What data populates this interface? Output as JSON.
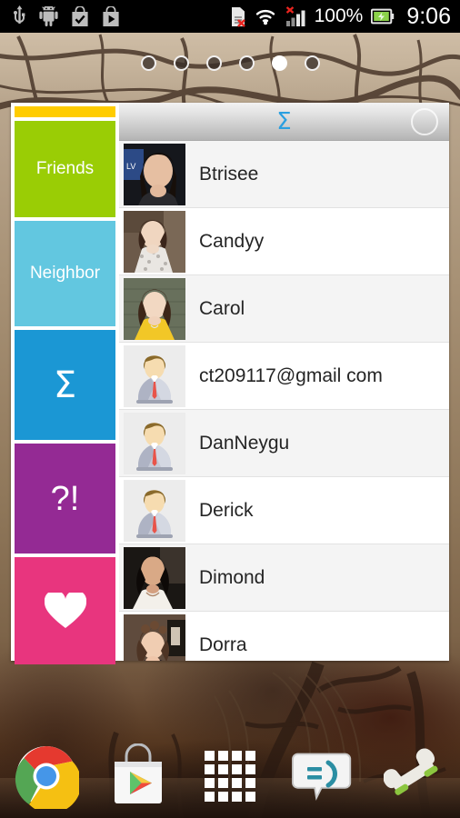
{
  "statusbar": {
    "left_icons": [
      "usb-icon",
      "android-icon",
      "bag-check-icon",
      "bag-play-icon"
    ],
    "right_icons": [
      "sdcard-error-icon",
      "wifi-icon",
      "signal-error-icon",
      "battery-charging-icon"
    ],
    "battery_text": "100%",
    "clock": "9:06"
  },
  "homescreen": {
    "page_count": 6,
    "active_page": 5
  },
  "widget": {
    "accent_bar_color": "#FFCC00",
    "tiles": [
      {
        "label": "Friends",
        "symbol": "",
        "color": "#9ACD05",
        "name": "tile-friends"
      },
      {
        "label": "Neighbor",
        "symbol": "",
        "color": "#62C7E0",
        "name": "tile-neighbor"
      },
      {
        "label": "",
        "symbol": "Σ",
        "color": "#1B97D4",
        "name": "tile-sigma"
      },
      {
        "label": "",
        "symbol": "?!",
        "color": "#942A94",
        "name": "tile-question"
      },
      {
        "label": "",
        "symbol": "♥",
        "color": "#E8357E",
        "name": "tile-favorites"
      }
    ],
    "list": {
      "header_symbol": "Σ",
      "header_symbol_color": "#2a9fe0",
      "header_circle": "refresh-circle-icon",
      "contacts": [
        {
          "name": "Btrisee",
          "avatar": "photo"
        },
        {
          "name": "Candyy",
          "avatar": "photo"
        },
        {
          "name": "Carol",
          "avatar": "photo"
        },
        {
          "name": "ct209117@gmail com",
          "avatar": "default"
        },
        {
          "name": "DanNeygu",
          "avatar": "default"
        },
        {
          "name": "Derick",
          "avatar": "default"
        },
        {
          "name": "Dimond",
          "avatar": "photo"
        },
        {
          "name": "Dorra",
          "avatar": "photo"
        }
      ]
    }
  },
  "dock": {
    "items": [
      {
        "label": "Chrome",
        "name": "dock-chrome"
      },
      {
        "label": "Play Store",
        "name": "dock-play-store"
      },
      {
        "label": "Apps",
        "name": "dock-app-drawer"
      },
      {
        "label": "Messaging",
        "name": "dock-messaging"
      },
      {
        "label": "Phone",
        "name": "dock-phone"
      }
    ]
  }
}
